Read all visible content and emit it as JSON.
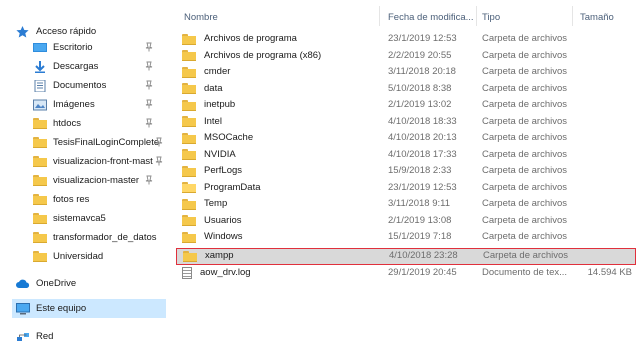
{
  "nav": {
    "quick_access": "Acceso rápido",
    "items": [
      {
        "label": "Escritorio",
        "icon": "desktop-icon",
        "pinned": true
      },
      {
        "label": "Descargas",
        "icon": "downloads-icon",
        "pinned": true
      },
      {
        "label": "Documentos",
        "icon": "documents-icon",
        "pinned": true
      },
      {
        "label": "Imágenes",
        "icon": "pictures-icon",
        "pinned": true
      },
      {
        "label": "htdocs",
        "icon": "folder-icon",
        "pinned": true
      },
      {
        "label": "TesisFinalLoginComplete",
        "icon": "folder-icon",
        "pinned": true
      },
      {
        "label": "visualizacion-front-mast",
        "icon": "folder-icon",
        "pinned": true
      },
      {
        "label": "visualizacion-master",
        "icon": "folder-icon",
        "pinned": true
      },
      {
        "label": "fotos res",
        "icon": "folder-icon",
        "pinned": false
      },
      {
        "label": "sistemavca5",
        "icon": "folder-icon",
        "pinned": false
      },
      {
        "label": "transformador_de_datos",
        "icon": "folder-icon",
        "pinned": false
      },
      {
        "label": "Universidad",
        "icon": "folder-icon",
        "pinned": false
      }
    ],
    "onedrive": "OneDrive",
    "this_pc": "Este equipo",
    "network": "Red"
  },
  "columns": {
    "name": "Nombre",
    "date": "Fecha de modifica...",
    "type": "Tipo",
    "size": "Tamaño"
  },
  "files": [
    {
      "name": "Archivos de programa",
      "date": "23/1/2019 12:53",
      "type": "Carpeta de archivos",
      "size": "",
      "kind": "folder"
    },
    {
      "name": "Archivos de programa (x86)",
      "date": "2/2/2019 20:55",
      "type": "Carpeta de archivos",
      "size": "",
      "kind": "folder"
    },
    {
      "name": "cmder",
      "date": "3/11/2018 20:18",
      "type": "Carpeta de archivos",
      "size": "",
      "kind": "folder"
    },
    {
      "name": "data",
      "date": "5/10/2018 8:38",
      "type": "Carpeta de archivos",
      "size": "",
      "kind": "folder"
    },
    {
      "name": "inetpub",
      "date": "2/1/2019 13:02",
      "type": "Carpeta de archivos",
      "size": "",
      "kind": "folder"
    },
    {
      "name": "Intel",
      "date": "4/10/2018 18:33",
      "type": "Carpeta de archivos",
      "size": "",
      "kind": "folder"
    },
    {
      "name": "MSOCache",
      "date": "4/10/2018 20:13",
      "type": "Carpeta de archivos",
      "size": "",
      "kind": "folder"
    },
    {
      "name": "NVIDIA",
      "date": "4/10/2018 17:33",
      "type": "Carpeta de archivos",
      "size": "",
      "kind": "folder"
    },
    {
      "name": "PerfLogs",
      "date": "15/9/2018 2:33",
      "type": "Carpeta de archivos",
      "size": "",
      "kind": "folder"
    },
    {
      "name": "ProgramData",
      "date": "23/1/2019 12:53",
      "type": "Carpeta de archivos",
      "size": "",
      "kind": "folder"
    },
    {
      "name": "Temp",
      "date": "3/11/2018 9:11",
      "type": "Carpeta de archivos",
      "size": "",
      "kind": "folder"
    },
    {
      "name": "Usuarios",
      "date": "2/1/2019 13:08",
      "type": "Carpeta de archivos",
      "size": "",
      "kind": "folder"
    },
    {
      "name": "Windows",
      "date": "15/1/2019 7:18",
      "type": "Carpeta de archivos",
      "size": "",
      "kind": "folder"
    },
    {
      "name": "xampp",
      "date": "4/10/2018 23:28",
      "type": "Carpeta de archivos",
      "size": "",
      "kind": "folder",
      "selected": true
    },
    {
      "name": "aow_drv.log",
      "date": "29/1/2019 20:45",
      "type": "Documento de tex...",
      "size": "14.594 KB",
      "kind": "file"
    }
  ],
  "colors": {
    "selection_border": "#e0303c",
    "selected_row": "#d9d9d9",
    "nav_selected": "#cce8ff",
    "folder": "#f5c84b"
  }
}
